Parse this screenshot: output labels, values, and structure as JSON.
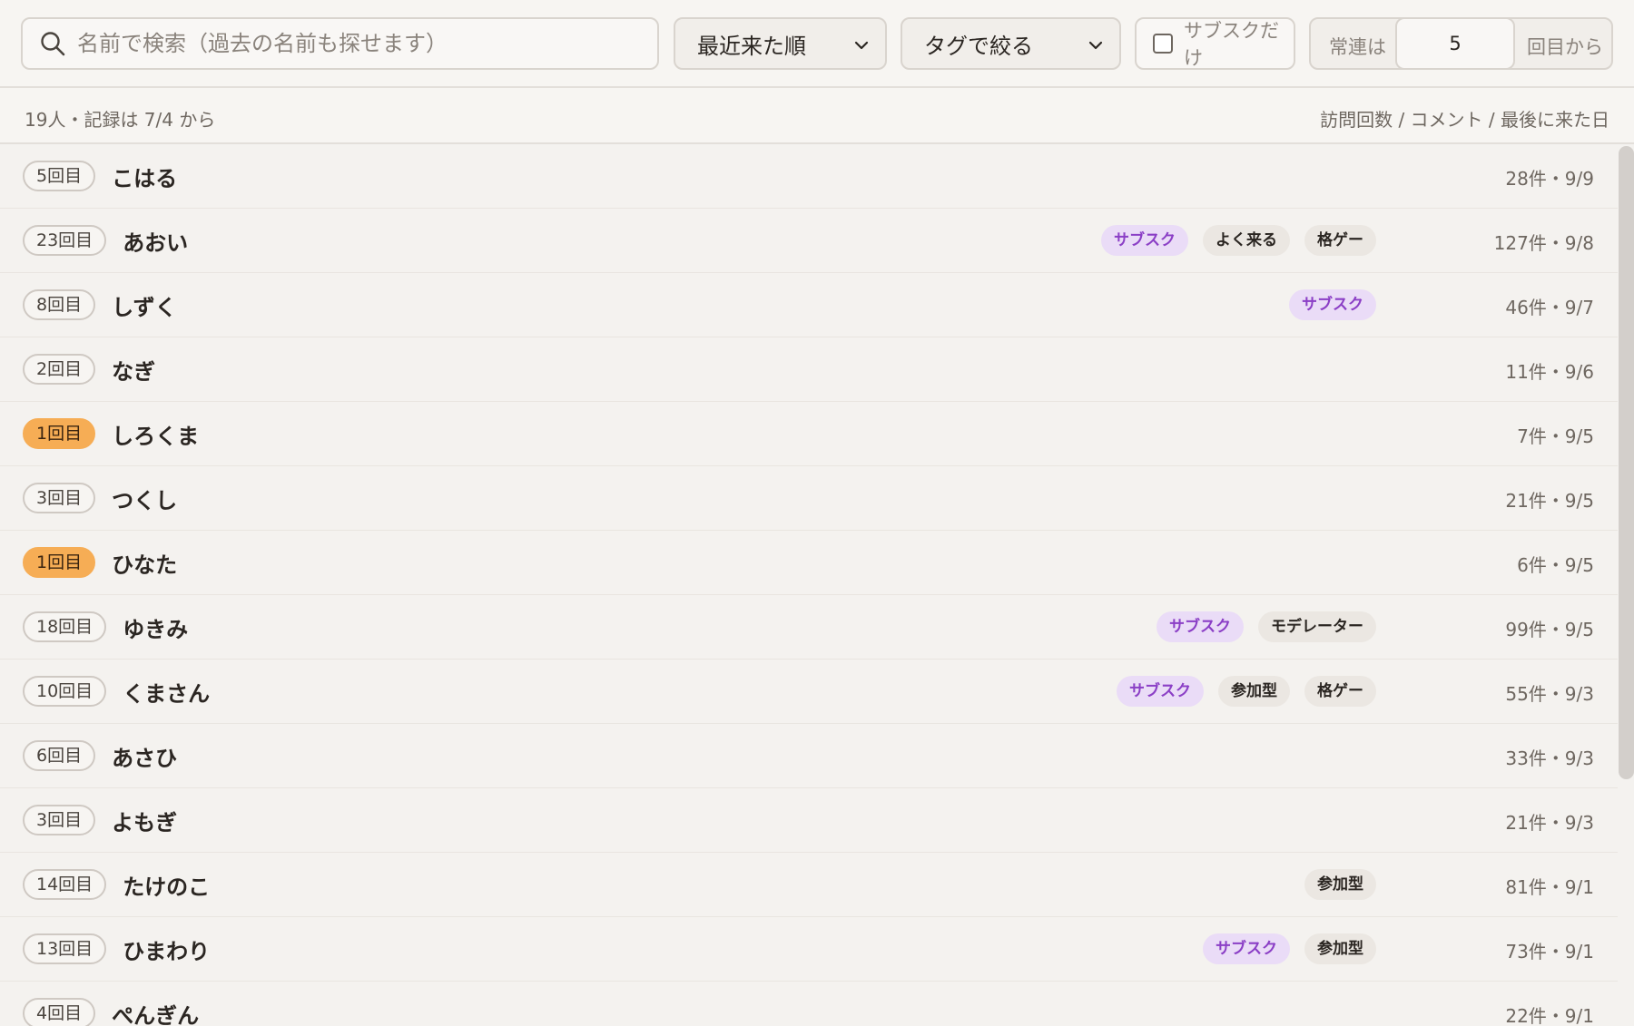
{
  "toolbar": {
    "search_placeholder": "名前で検索（過去の名前も探せます）",
    "sort_value": "最近来た順",
    "tag_filter_value": "タグで絞る",
    "subscriber_only_label": "サブスクだけ",
    "subscriber_only_checked": false,
    "regular_prefix": "常連は",
    "regular_threshold": "5",
    "regular_suffix": "回目から"
  },
  "summary": {
    "count_text": "19人・記録は 7/4 から",
    "columns_text": "訪問回数 / コメント / 最後に来た日"
  },
  "colors": {
    "accent_first_visit": "#f6ad55",
    "subscriber_tag_bg": "#eadcf7",
    "subscriber_tag_text": "#8b3fc6",
    "neutral_tag_bg": "#ebe7e2"
  },
  "viewers": [
    {
      "visit": "5回目",
      "name": "こはる",
      "tags": [],
      "meta": "28件・9/9",
      "first": false
    },
    {
      "visit": "23回目",
      "name": "あおい",
      "tags": [
        {
          "label": "サブスク",
          "kind": "sub"
        },
        {
          "label": "よく来る",
          "kind": "normal"
        },
        {
          "label": "格ゲー",
          "kind": "normal"
        }
      ],
      "meta": "127件・9/8",
      "first": false
    },
    {
      "visit": "8回目",
      "name": "しずく",
      "tags": [
        {
          "label": "サブスク",
          "kind": "sub"
        }
      ],
      "meta": "46件・9/7",
      "first": false
    },
    {
      "visit": "2回目",
      "name": "なぎ",
      "tags": [],
      "meta": "11件・9/6",
      "first": false
    },
    {
      "visit": "1回目",
      "name": "しろくま",
      "tags": [],
      "meta": "7件・9/5",
      "first": true
    },
    {
      "visit": "3回目",
      "name": "つくし",
      "tags": [],
      "meta": "21件・9/5",
      "first": false
    },
    {
      "visit": "1回目",
      "name": "ひなた",
      "tags": [],
      "meta": "6件・9/5",
      "first": true
    },
    {
      "visit": "18回目",
      "name": "ゆきみ",
      "tags": [
        {
          "label": "サブスク",
          "kind": "sub"
        },
        {
          "label": "モデレーター",
          "kind": "normal"
        }
      ],
      "meta": "99件・9/5",
      "first": false
    },
    {
      "visit": "10回目",
      "name": "くまさん",
      "tags": [
        {
          "label": "サブスク",
          "kind": "sub"
        },
        {
          "label": "参加型",
          "kind": "normal"
        },
        {
          "label": "格ゲー",
          "kind": "normal"
        }
      ],
      "meta": "55件・9/3",
      "first": false
    },
    {
      "visit": "6回目",
      "name": "あさひ",
      "tags": [],
      "meta": "33件・9/3",
      "first": false
    },
    {
      "visit": "3回目",
      "name": "よもぎ",
      "tags": [],
      "meta": "21件・9/3",
      "first": false
    },
    {
      "visit": "14回目",
      "name": "たけのこ",
      "tags": [
        {
          "label": "参加型",
          "kind": "normal"
        }
      ],
      "meta": "81件・9/1",
      "first": false
    },
    {
      "visit": "13回目",
      "name": "ひまわり",
      "tags": [
        {
          "label": "サブスク",
          "kind": "sub"
        },
        {
          "label": "参加型",
          "kind": "normal"
        }
      ],
      "meta": "73件・9/1",
      "first": false
    },
    {
      "visit": "4回目",
      "name": "ぺんぎん",
      "tags": [],
      "meta": "22件・9/1",
      "first": false
    }
  ]
}
